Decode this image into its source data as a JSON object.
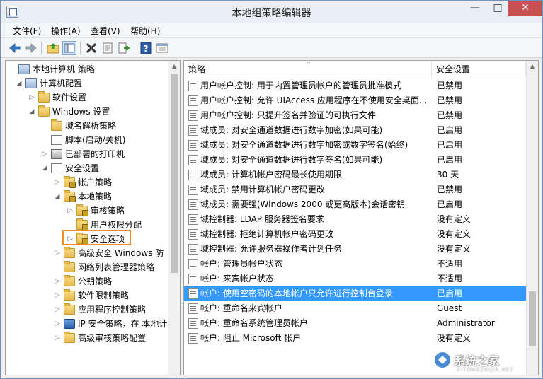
{
  "window": {
    "title": "本地组策略编辑器"
  },
  "titlebar_buttons": {
    "minimize": "—",
    "maximize": "□",
    "close": "✕"
  },
  "menu": [
    {
      "label": "文件(F)"
    },
    {
      "label": "操作(A)"
    },
    {
      "label": "查看(V)"
    },
    {
      "label": "帮助(H)"
    }
  ],
  "toolbar": [
    {
      "icon": "back-arrow-icon"
    },
    {
      "icon": "forward-arrow-icon"
    },
    {
      "icon": "up-folder-icon"
    },
    {
      "icon": "show-hide-tree-icon"
    },
    {
      "icon": "delete-icon"
    },
    {
      "icon": "properties-icon"
    },
    {
      "icon": "export-list-icon"
    },
    {
      "icon": "help-icon"
    },
    {
      "icon": "view-icon"
    }
  ],
  "tree": [
    {
      "label": "本地计算机 策略",
      "toggle": "",
      "icon": "computer-policy-icon",
      "depth": 0
    },
    {
      "label": "计算机配置",
      "toggle": "◢",
      "icon": "computer-icon",
      "depth": 1
    },
    {
      "label": "软件设置",
      "toggle": "▷",
      "icon": "folder-icon",
      "depth": 2
    },
    {
      "label": "Windows 设置",
      "toggle": "◢",
      "icon": "folder-icon",
      "depth": 2
    },
    {
      "label": "域名解析策略",
      "toggle": "",
      "icon": "folder-icon",
      "depth": 3
    },
    {
      "label": "脚本(启动/关机)",
      "toggle": "",
      "icon": "script-icon",
      "depth": 3
    },
    {
      "label": "已部署的打印机",
      "toggle": "▷",
      "icon": "printer-icon",
      "depth": 3
    },
    {
      "label": "安全设置",
      "toggle": "◢",
      "icon": "security-settings-icon",
      "depth": 3
    },
    {
      "label": "帐户策略",
      "toggle": "▷",
      "icon": "locked-folder-icon",
      "depth": 4
    },
    {
      "label": "本地策略",
      "toggle": "◢",
      "icon": "locked-folder-icon",
      "depth": 4
    },
    {
      "label": "审核策略",
      "toggle": "▷",
      "icon": "locked-folder-icon",
      "depth": 5
    },
    {
      "label": "用户权限分配",
      "toggle": "",
      "icon": "locked-folder-icon",
      "depth": 5
    },
    {
      "label": "安全选项",
      "toggle": "▷",
      "icon": "locked-folder-icon",
      "depth": 5,
      "highlighted": true
    },
    {
      "label": "高级安全 Windows 防",
      "toggle": "▷",
      "icon": "folder-icon",
      "depth": 4
    },
    {
      "label": "网络列表管理器策略",
      "toggle": "",
      "icon": "folder-icon",
      "depth": 4
    },
    {
      "label": "公钥策略",
      "toggle": "▷",
      "icon": "folder-icon",
      "depth": 4
    },
    {
      "label": "软件限制策略",
      "toggle": "▷",
      "icon": "folder-icon",
      "depth": 4
    },
    {
      "label": "应用程序控制策略",
      "toggle": "▷",
      "icon": "folder-icon",
      "depth": 4
    },
    {
      "label": "IP 安全策略，在 本地计",
      "toggle": "▷",
      "icon": "ip-security-icon",
      "depth": 4
    },
    {
      "label": "高级审核策略配置",
      "toggle": "▷",
      "icon": "folder-icon",
      "depth": 4
    }
  ],
  "list": {
    "columns": [
      "策略",
      "安全设置"
    ],
    "rows": [
      {
        "policy": "用户帐户控制: 用于内置管理员帐户的管理员批准模式",
        "setting": "已禁用"
      },
      {
        "policy": "用户帐户控制: 允许 UIAccess 应用程序在不使用安全桌面...",
        "setting": "已禁用"
      },
      {
        "policy": "用户帐户控制: 只提升签名并验证的可执行文件",
        "setting": "已禁用"
      },
      {
        "policy": "域成员: 对安全通道数据进行数字加密(如果可能)",
        "setting": "已启用"
      },
      {
        "policy": "域成员: 对安全通道数据进行数字加密或数字签名(始终)",
        "setting": "已启用"
      },
      {
        "policy": "域成员: 对安全通道数据进行数字签名(如果可能)",
        "setting": "已启用"
      },
      {
        "policy": "域成员: 计算机帐户密码最长使用期限",
        "setting": "30 天"
      },
      {
        "policy": "域成员: 禁用计算机帐户密码更改",
        "setting": "已禁用"
      },
      {
        "policy": "域成员: 需要强(Windows 2000 或更高版本)会话密钥",
        "setting": "已启用"
      },
      {
        "policy": "域控制器: LDAP 服务器签名要求",
        "setting": "没有定义"
      },
      {
        "policy": "域控制器: 拒绝计算机帐户密码更改",
        "setting": "没有定义"
      },
      {
        "policy": "域控制器: 允许服务器操作者计划任务",
        "setting": "没有定义"
      },
      {
        "policy": "帐户: 管理员帐户状态",
        "setting": "不适用"
      },
      {
        "policy": "帐户: 来宾帐户状态",
        "setting": "不适用"
      },
      {
        "policy": "帐户: 使用空密码的本地帐户只允许进行控制台登录",
        "setting": "已启用",
        "selected": true
      },
      {
        "policy": "帐户: 重命名来宾帐户",
        "setting": "Guest"
      },
      {
        "policy": "帐户: 重命名系统管理员帐户",
        "setting": "Administrator"
      },
      {
        "policy": "帐户: 阻止 Microsoft 帐户",
        "setting": "没有定义"
      }
    ]
  },
  "watermark": {
    "text": "系统之家",
    "subtext": "XITONGZHIJIA.NET"
  },
  "colors": {
    "selection": "#3399ff",
    "highlight_box": "#f08a2a",
    "close_button": "#c75050"
  }
}
